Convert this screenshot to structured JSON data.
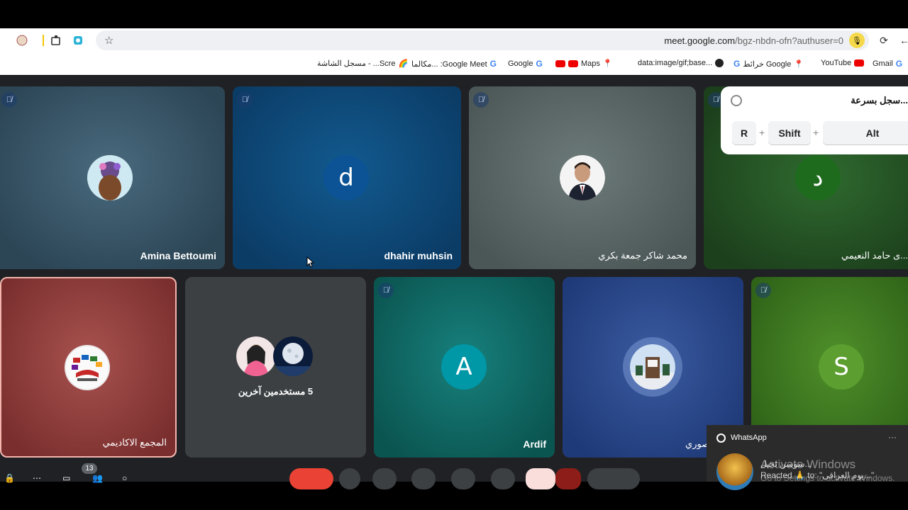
{
  "browser": {
    "url_main": "meet.google.com",
    "url_rest": "/bgz-nbdn-ofn?authuser=0"
  },
  "bookmarks": [
    {
      "label": "Gmail",
      "icon": "google-icon"
    },
    {
      "label": "YouTube",
      "icon": "youtube-icon"
    },
    {
      "label": "خرائط Google",
      "icon": "maps-icon"
    },
    {
      "label": "data:image/gif;base...",
      "icon": "globe-icon"
    },
    {
      "label": "Maps",
      "icon": "maps-icon"
    },
    {
      "label": "Google",
      "icon": "google-icon"
    },
    {
      "label": "مكالما... :Google Meet",
      "icon": "google-icon"
    },
    {
      "label": "مسجل الشاشة - ...Scre",
      "icon": "rainbow-icon"
    }
  ],
  "tiles_row1": [
    {
      "name": "Amina Bettoumi",
      "avatar_type": "photo"
    },
    {
      "name": "dhahir muhsin",
      "initial": "d",
      "color": "#0b5394"
    },
    {
      "name": "محمد شاكر جمعة بكري",
      "avatar_type": "photo"
    },
    {
      "name": "...ى حامد النعيمي",
      "initial": "د",
      "color": "#1e6b1e"
    }
  ],
  "tiles_row2": [
    {
      "name": "المجمع الاكاديمي",
      "avatar_type": "logo"
    },
    {
      "name": "5 مستخدمين آخرين",
      "avatar_type": "group"
    },
    {
      "name": "Ardif",
      "initial": "A",
      "color": "#0097a7"
    },
    {
      "name": "...ى منصوري",
      "avatar_type": "photo"
    },
    {
      "name": "",
      "initial": "S",
      "color": "#5c9e2f"
    }
  ],
  "shortcut_popup": {
    "title": "...سجل بسرعة",
    "keys": [
      "R",
      "Shift",
      "Alt"
    ]
  },
  "bottom": {
    "participant_count": "13"
  },
  "whatsapp_toast": {
    "app": "WhatsApp",
    "more": "···",
    "sender": "...سوسن ثجيل",
    "message": "Reacted 🙏 to: \"يوم العراقي...\""
  },
  "watermark": {
    "line1": "Activate Windows",
    "line2": "Go to Settings to activate Windows."
  },
  "colors": {
    "meet_bg": "#202124",
    "end_call": "#ea4335"
  }
}
